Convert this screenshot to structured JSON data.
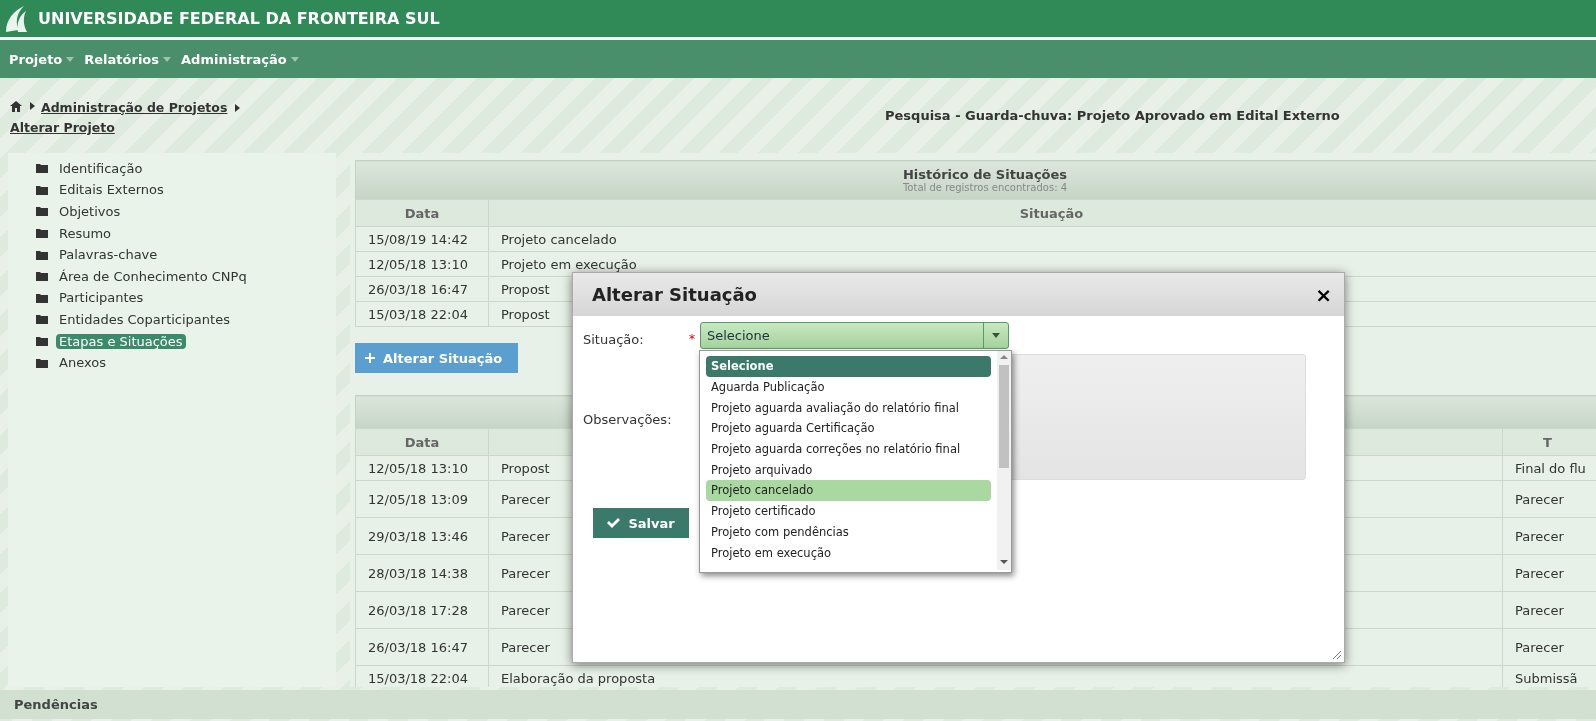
{
  "header": {
    "title": "UNIVERSIDADE FEDERAL DA FRONTEIRA SUL"
  },
  "menu": [
    {
      "label": "Projeto"
    },
    {
      "label": "Relatórios"
    },
    {
      "label": "Administração"
    }
  ],
  "breadcrumb": {
    "links": [
      "Administração de Projetos",
      "Alterar Projeto"
    ]
  },
  "project_title": "Pesquisa - Guarda-chuva: Projeto Aprovado em Edital Externo",
  "sidebar": {
    "items": [
      {
        "label": "Identificação",
        "selected": false
      },
      {
        "label": "Editais Externos",
        "selected": false
      },
      {
        "label": "Objetivos",
        "selected": false
      },
      {
        "label": "Resumo",
        "selected": false
      },
      {
        "label": "Palavras-chave",
        "selected": false
      },
      {
        "label": "Área de Conhecimento CNPq",
        "selected": false
      },
      {
        "label": "Participantes",
        "selected": false
      },
      {
        "label": "Entidades Coparticipantes",
        "selected": false
      },
      {
        "label": "Etapas e Situações",
        "selected": true
      },
      {
        "label": "Anexos",
        "selected": false
      }
    ]
  },
  "history_table": {
    "title": "Histórico de Situações",
    "subtitle": "Total de registros encontrados: 4",
    "columns": [
      "Data",
      "Situação"
    ],
    "rows": [
      [
        "15/08/19 14:42",
        "Projeto cancelado"
      ],
      [
        "12/05/18 13:10",
        "Projeto em execução"
      ],
      [
        "26/03/18 16:47",
        "Propost"
      ],
      [
        "15/03/18 22:04",
        "Propost"
      ]
    ]
  },
  "change_button": "Alterar Situação",
  "steps_table": {
    "columns": [
      "Data",
      "",
      "T"
    ],
    "rows": [
      [
        "12/05/18 13:10",
        "Propost",
        "Final do flu"
      ],
      [
        "12/05/18 13:09",
        "Parecer",
        "Parecer"
      ],
      [
        "29/03/18 13:46",
        "Parecer",
        "Parecer"
      ],
      [
        "28/03/18 14:38",
        "Parecer",
        "Parecer"
      ],
      [
        "26/03/18 17:28",
        "Parecer",
        "Parecer"
      ],
      [
        "26/03/18 16:47",
        "Parecer",
        "Parecer"
      ],
      [
        "15/03/18 22:04",
        "Elaboração da proposta",
        "Submissã"
      ]
    ]
  },
  "footer_bar": "Pendências",
  "modal": {
    "title": "Alterar Situação",
    "close": "×",
    "situacao_label": "Situação:",
    "required_mark": "*",
    "select_value": "Selecione",
    "observacoes_label": "Observações:",
    "save_button": "Salvar",
    "options": [
      {
        "label": "Selecione",
        "selected": true,
        "highlighted": false
      },
      {
        "label": "Aguarda Publicação",
        "selected": false,
        "highlighted": false
      },
      {
        "label": "Projeto aguarda avaliação do relatório final",
        "selected": false,
        "highlighted": false
      },
      {
        "label": "Projeto aguarda Certificação",
        "selected": false,
        "highlighted": false
      },
      {
        "label": "Projeto aguarda correções no relatório final",
        "selected": false,
        "highlighted": false
      },
      {
        "label": "Projeto arquivado",
        "selected": false,
        "highlighted": false
      },
      {
        "label": "Projeto cancelado",
        "selected": false,
        "highlighted": true
      },
      {
        "label": "Projeto certificado",
        "selected": false,
        "highlighted": false
      },
      {
        "label": "Projeto com pendências",
        "selected": false,
        "highlighted": false
      },
      {
        "label": "Projeto em execução",
        "selected": false,
        "highlighted": false
      }
    ]
  }
}
